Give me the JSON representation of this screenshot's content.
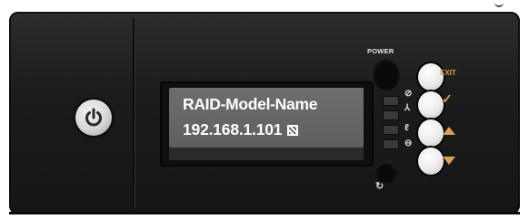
{
  "lcd": {
    "line1": "RAID-Model-Name",
    "line2": "192.168.1.101"
  },
  "labels": {
    "power": "POWER",
    "exit": "EXIT"
  },
  "icons": {
    "power_button": "power-icon",
    "lcd_status": "network-status-icon",
    "reset": "reset-icon",
    "check": "check-icon",
    "up": "up-arrow-icon",
    "down": "down-arrow-icon"
  },
  "colors": {
    "panel": "#1c1c1c",
    "lcd_background": "#5f5f5f",
    "lcd_text": "#ffffff",
    "key_label": "#d8a24a"
  }
}
